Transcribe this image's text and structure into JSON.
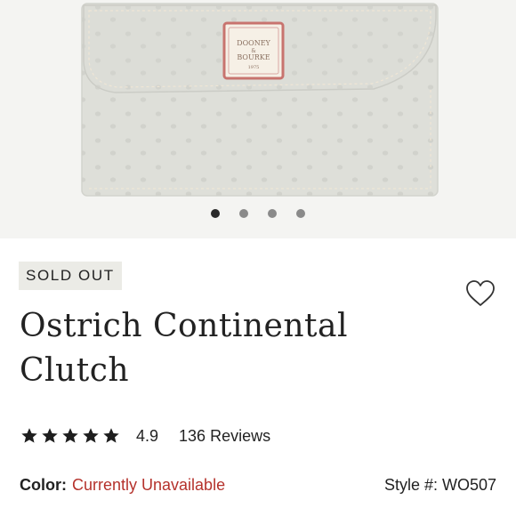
{
  "product": {
    "image_brand_text": [
      "DOONEY",
      "&",
      "BOURKE",
      "1975"
    ],
    "carousel": {
      "total": 4,
      "active_index": 0
    },
    "badge": "SOLD OUT",
    "title_line1": "Ostrich Continental",
    "title_line2": "Clutch",
    "rating": {
      "stars": 5,
      "value": "4.9",
      "reviews": "136 Reviews"
    },
    "color": {
      "label": "Color:",
      "value": "Currently Unavailable"
    },
    "style": {
      "label": "Style #:",
      "value": "WO507"
    }
  },
  "colors": {
    "unavailable_text": "#b5322c",
    "badge_bg": "#ebebe6",
    "wallet_leather": "#dedfd9",
    "logo_border": "#c8736e"
  },
  "icons": {
    "wishlist": "heart-outline-icon",
    "star": "star-icon"
  }
}
